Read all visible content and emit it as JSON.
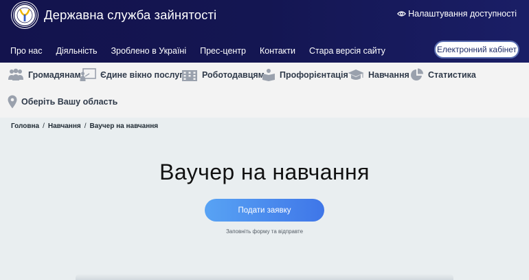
{
  "header": {
    "site_title": "Державна служба зайнятості",
    "accessibility_label": "Налаштування доступності",
    "cabinet_label": "Електронний кабінет"
  },
  "main_nav": [
    {
      "label": "Про нас"
    },
    {
      "label": "Діяльність"
    },
    {
      "label": "Зроблено в Україні"
    },
    {
      "label": "Прес-центр"
    },
    {
      "label": "Контакти"
    },
    {
      "label": "Стара версія сайту"
    }
  ],
  "categories": [
    {
      "label": "Громадянам",
      "icon": "people-icon"
    },
    {
      "label": "Єдине вікно послуг",
      "icon": "presentation-icon"
    },
    {
      "label": "Роботодавцям",
      "icon": "building-icon"
    },
    {
      "label": "Профорієнтація",
      "icon": "book-person-icon"
    },
    {
      "label": "Навчання",
      "icon": "graduation-cap-icon"
    },
    {
      "label": "Статистика",
      "icon": "pie-chart-icon"
    },
    {
      "label": "Оберіть Вашу область",
      "icon": "location-pin-icon"
    }
  ],
  "breadcrumb": [
    {
      "label": "Головна"
    },
    {
      "label": "Навчання"
    },
    {
      "label": "Ваучер на навчання"
    }
  ],
  "breadcrumb_separator": "/",
  "content": {
    "title": "Ваучер на навчання",
    "apply_label": "Подати заявку",
    "hint": "Заповніть форму та відправте"
  },
  "colors": {
    "header_bg": "#141652",
    "accent_blue": "#3f76e8",
    "category_icon": "#9aa1ad"
  }
}
